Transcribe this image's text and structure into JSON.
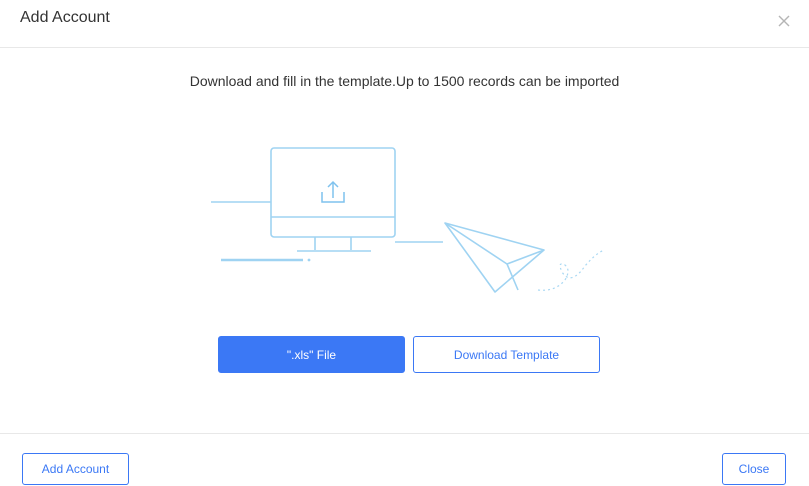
{
  "dialog": {
    "title": "Add Account",
    "close_icon": "close-icon"
  },
  "main": {
    "instruction": "Download and fill in the template.Up to 1500 records can be imported",
    "illustration_icons": [
      "monitor-icon",
      "upload-icon",
      "paper-plane-icon"
    ],
    "upload_button_label": "\".xls\" File",
    "download_template_label": "Download Template"
  },
  "footer": {
    "add_account_label": "Add Account",
    "close_label": "Close"
  },
  "colors": {
    "accent": "#3b78f5",
    "illustration": "#9fd3f2",
    "divider": "#e8e8e8"
  }
}
